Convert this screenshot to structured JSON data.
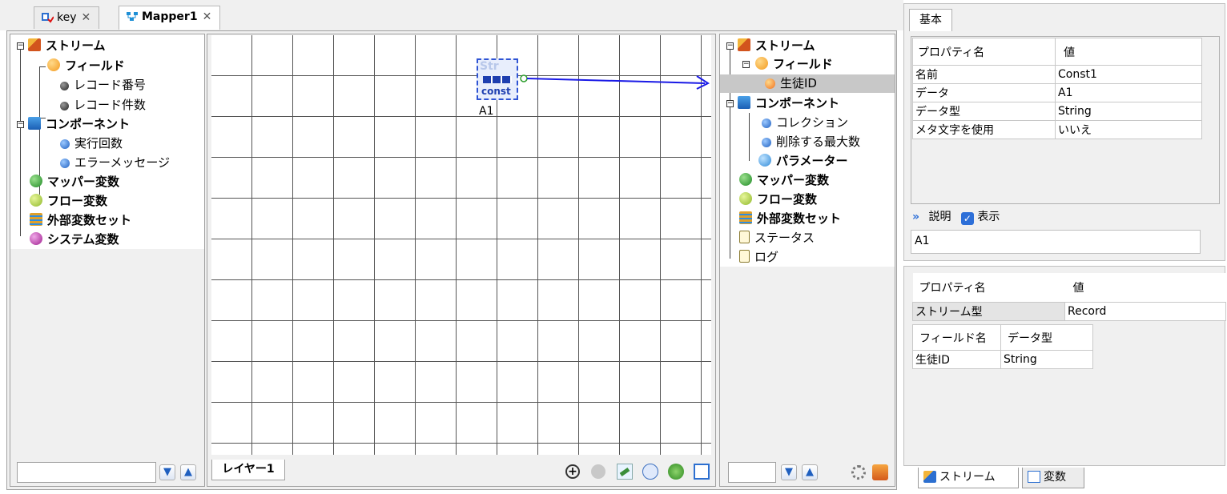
{
  "tabs": [
    {
      "label": "key",
      "close": "✕"
    },
    {
      "label": "Mapper1",
      "close": "✕"
    }
  ],
  "left_tree": {
    "stream": "ストリーム",
    "field": "フィールド",
    "record_no": "レコード番号",
    "record_count": "レコード件数",
    "component": "コンポーネント",
    "exec_count": "実行回数",
    "error_message": "エラーメッセージ",
    "mapper_var": "マッパー変数",
    "flow_var": "フロー変数",
    "ext_var_set": "外部変数セット",
    "system_var": "システム変数"
  },
  "canvas": {
    "const_icon_top": "Str",
    "const_icon_bottom": "const",
    "const_label": "A1",
    "layer_tab": "レイヤー1"
  },
  "right_tree": {
    "stream": "ストリーム",
    "field": "フィールド",
    "student_id": "生徒ID",
    "component": "コンポーネント",
    "collection": "コレクション",
    "max_delete": "削除する最大数",
    "parameter": "パラメーター",
    "mapper_var": "マッパー変数",
    "flow_var": "フロー変数",
    "ext_var_set": "外部変数セット",
    "status": "ステータス",
    "log": "ログ"
  },
  "props_top": {
    "tab": "基本",
    "col_name": "プロパティ名",
    "col_value": "値",
    "rows": [
      {
        "name": "名前",
        "value": "Const1"
      },
      {
        "name": "データ",
        "value": "A1"
      },
      {
        "name": "データ型",
        "value": "String"
      },
      {
        "name": "メタ文字を使用",
        "value": "いいえ"
      }
    ],
    "description_label": "説明",
    "show_label": "表示",
    "description_value": "A1"
  },
  "props_bottom": {
    "col_name": "プロパティ名",
    "col_value": "値",
    "stream_type_name": "ストリーム型",
    "stream_type_value": "Record",
    "field_col": "フィールド名",
    "type_col": "データ型",
    "field_rows": [
      {
        "name": "生徒ID",
        "type": "String"
      }
    ]
  },
  "bottom_tabs": {
    "stream": "ストリーム",
    "variable": "変数"
  },
  "colors": {
    "accent_blue": "#1f5fbf",
    "arrow_blue": "#1a1ae6",
    "orange": "#f39a1e",
    "green": "#2e9e2e"
  }
}
